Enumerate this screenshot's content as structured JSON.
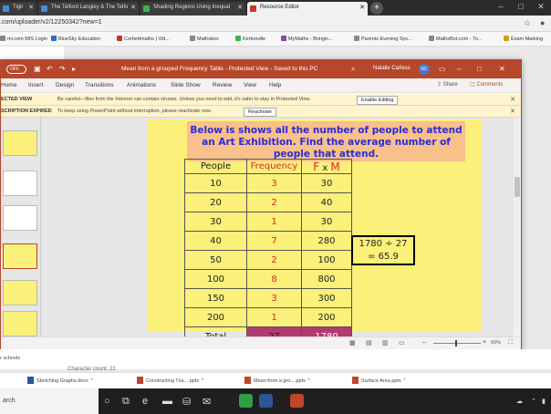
{
  "browser": {
    "tabs": [
      {
        "label": "Tiglr",
        "active": false
      },
      {
        "label": "The Telford Langley & The Telfo",
        "active": false
      },
      {
        "label": "Shading Regions Using Inequal",
        "active": false
      },
      {
        "label": "Resource Editor",
        "active": true
      }
    ],
    "url": ".com/uploader/v2/12250342?new=1",
    "bookmarks": [
      "mi.com MIS Login",
      "BlueSky Education",
      "Corbettmaths | Vid...",
      "Mathsbox",
      "Kerboodle",
      "MyMaths - Bringin...",
      "Parents Evening Sys...",
      "MathsBot.com - To...",
      "Exam Marking"
    ]
  },
  "ppt": {
    "autosave": "OFF",
    "doc_title": "Mean from a grouped Frequency Table  -  Protected View  -  Saved to this PC",
    "user_name": "Natalie Carless",
    "user_initials": "NC",
    "ribbon_tabs": [
      "Home",
      "Insert",
      "Design",
      "Transitions",
      "Animations",
      "Slide Show",
      "Review",
      "View",
      "Help"
    ],
    "share_label": "Share",
    "comments_label": "Comments",
    "protected_label": "ECTED VIEW",
    "protected_text": "Be careful—files from the Internet can contain viruses. Unless you need to edit, it's safer to stay in Protected View.",
    "enable_editing": "Enable Editing",
    "expired_label": "SCRIPTION EXPIRED",
    "expired_text": "To keep using PowerPoint without interruption, please reactivate now.",
    "reactivate": "Reactivate",
    "zoom": "60%"
  },
  "slide": {
    "heading": "Below is shows all the number of people to attend an Art Exhibition. Find the average number of people that attend.",
    "headers": {
      "people": "People",
      "frequency": "Frequency",
      "fxm_f": "F",
      "fxm_x": "x",
      "fxm_m": "M"
    },
    "rows": [
      {
        "people": "10",
        "frequency": "3",
        "fxm": "30"
      },
      {
        "people": "20",
        "frequency": "2",
        "fxm": "40"
      },
      {
        "people": "30",
        "frequency": "1",
        "fxm": "30"
      },
      {
        "people": "40",
        "frequency": "7",
        "fxm": "280"
      },
      {
        "people": "50",
        "frequency": "2",
        "fxm": "100"
      },
      {
        "people": "100",
        "frequency": "8",
        "fxm": "800"
      },
      {
        "people": "150",
        "frequency": "3",
        "fxm": "300"
      },
      {
        "people": "200",
        "frequency": "1",
        "fxm": "200"
      }
    ],
    "total_label": "Total",
    "total_frequency": "27",
    "total_fxm": "1780",
    "calc_line1": "1780 ÷ 27",
    "calc_line2": "= 65.9"
  },
  "page": {
    "character_count_label": "Character count:",
    "character_count": "22",
    "side_text": "r schools"
  },
  "downloads": [
    "Sketching Graphs.docx",
    "Constructing Tria....pptx",
    "Mean from a gro....pptx",
    "Surface Area.pptx"
  ],
  "taskbar": {
    "search_text": "arch"
  }
}
